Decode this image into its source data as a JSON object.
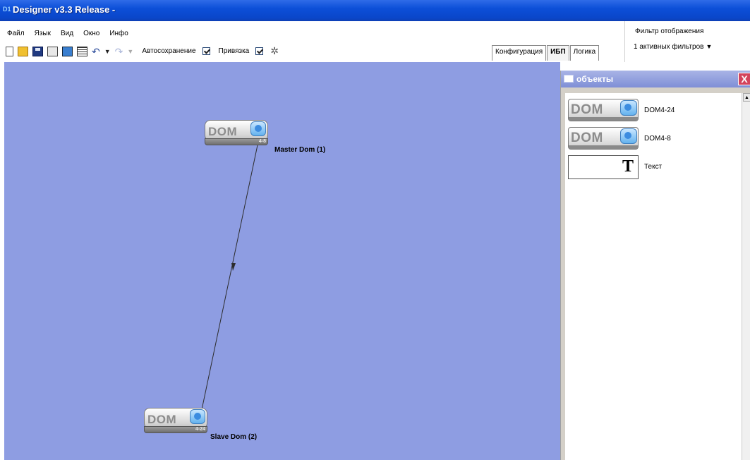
{
  "window": {
    "title": "Designer v3.3 Release -",
    "icon_text": "D1"
  },
  "menu": [
    {
      "label": "Файл"
    },
    {
      "label": "Язык"
    },
    {
      "label": "Вид"
    },
    {
      "label": "Окно"
    },
    {
      "label": "Инфо"
    }
  ],
  "toolbar": {
    "autosave_label": "Автосохранение",
    "autosave_checked": true,
    "snap_label": "Привязка",
    "snap_checked": true
  },
  "filter": {
    "title": "Фильтр отображения",
    "value": "1 активных фильтров",
    "caret": "▼"
  },
  "tabs": [
    {
      "label": "Конфигурация",
      "active": false
    },
    {
      "label": "ИБП",
      "active": true
    },
    {
      "label": "Логика",
      "active": false
    }
  ],
  "canvas": {
    "background": "#8e9de2",
    "nodes": [
      {
        "text": "DOM",
        "model": "4-8",
        "label": "Master Dom (1)"
      },
      {
        "text": "DOM",
        "model": "4-24",
        "label": "Slave Dom (2)"
      }
    ]
  },
  "panel": {
    "title": "объекты",
    "close_glyph": "X",
    "items": [
      {
        "tile_text": "DOM",
        "label": "DOM4-24"
      },
      {
        "tile_text": "DOM",
        "label": "DOM4-8"
      },
      {
        "tile_text": "T",
        "label": "Текст"
      }
    ]
  }
}
